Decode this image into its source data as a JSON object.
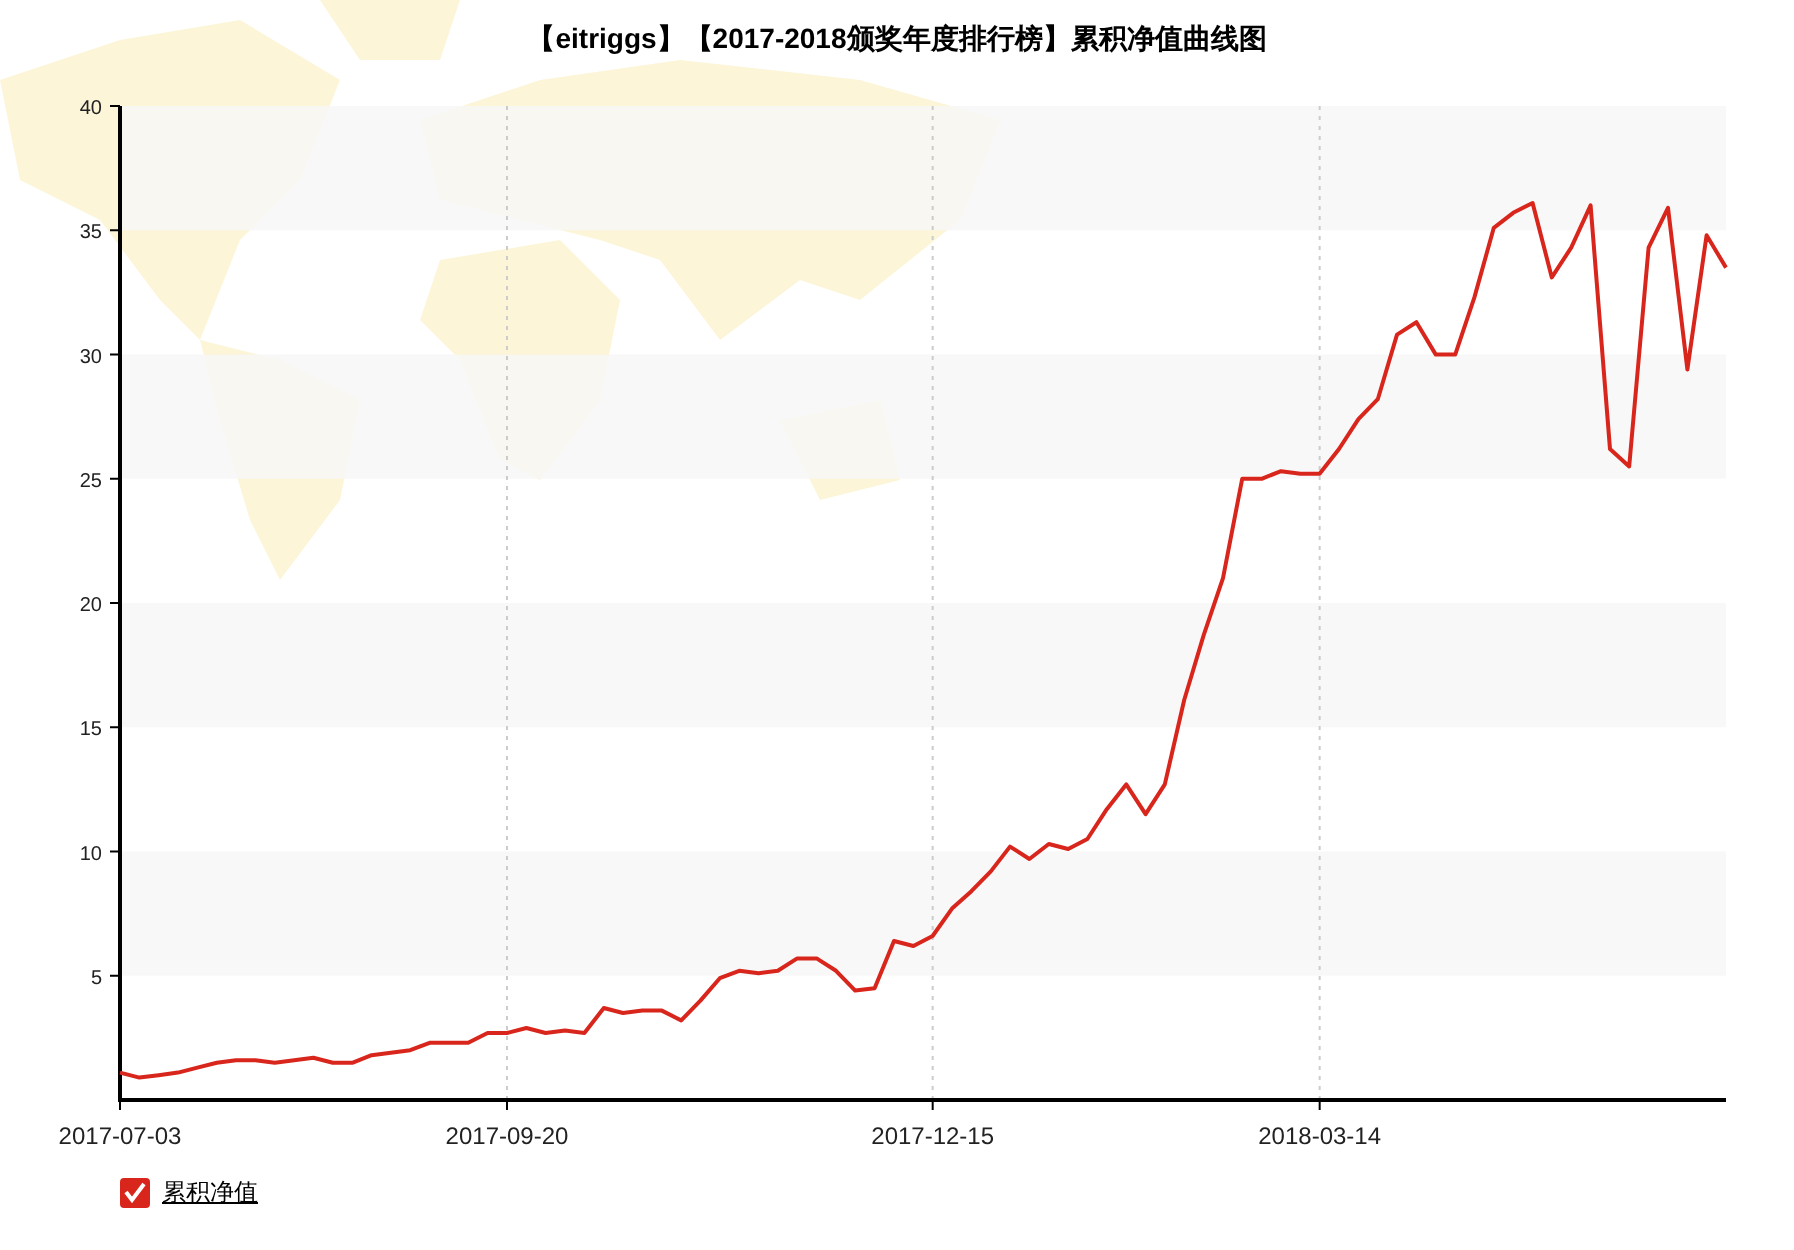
{
  "title": "【eitriggs】【2017-2018颁奖年度排行榜】累积净值曲线图",
  "chart": {
    "chart_data": {
      "type": "line",
      "categories": [
        "2017-07-03",
        null,
        null,
        null,
        null,
        null,
        null,
        null,
        null,
        null,
        null,
        null,
        null,
        null,
        null,
        null,
        null,
        null,
        null,
        null,
        "2017-09-20",
        null,
        null,
        null,
        null,
        null,
        null,
        null,
        null,
        null,
        null,
        null,
        null,
        null,
        null,
        null,
        null,
        null,
        null,
        null,
        null,
        null,
        "2017-12-15",
        null,
        null,
        null,
        null,
        null,
        null,
        null,
        null,
        null,
        null,
        null,
        null,
        null,
        null,
        null,
        null,
        null,
        null,
        null,
        "2018-03-14",
        null,
        null,
        null,
        null,
        null,
        null,
        null,
        null,
        null,
        null,
        null,
        null,
        null,
        null,
        null,
        null,
        null,
        null,
        null,
        null,
        null
      ],
      "series": [
        {
          "color": "#d9261c",
          "values": [
            1.1,
            0.9,
            1,
            1.1,
            1.3,
            1.5,
            1.6,
            1.6,
            1.5,
            1.6,
            1.7,
            1.5,
            1.5,
            1.8,
            1.9,
            2,
            2.3,
            2.3,
            2.3,
            2.7,
            2.7,
            2.9,
            2.7,
            2.8,
            2.7,
            3.7,
            3.5,
            3.6,
            3.6,
            3.2,
            4,
            4.9,
            5.2,
            5.1,
            5.2,
            5.7,
            5.7,
            5.2,
            4.4,
            4.5,
            6.4,
            6.2,
            6.6,
            7.7,
            8.4,
            9.2,
            10.2,
            9.7,
            10.3,
            10.1,
            10.5,
            11.7,
            12.7,
            11.5,
            12.7,
            16.1,
            18.7,
            21,
            25,
            25,
            25.3,
            25.2,
            25.2,
            26.2,
            27.4,
            28.2,
            30.8,
            31.3,
            30,
            30,
            32.3,
            35.1,
            35.7,
            36.1,
            33.1,
            34.3,
            36,
            26.2,
            25.5,
            34.3,
            35.9,
            29.4,
            34.8,
            33.5
          ]
        }
      ],
      "grid": true,
      "ylim": [
        0,
        40
      ],
      "yticks": [
        5,
        10,
        15,
        20,
        25,
        30,
        35,
        40
      ]
    }
  },
  "legend": [
    {
      "label": "累积净值",
      "checked": true
    }
  ]
}
